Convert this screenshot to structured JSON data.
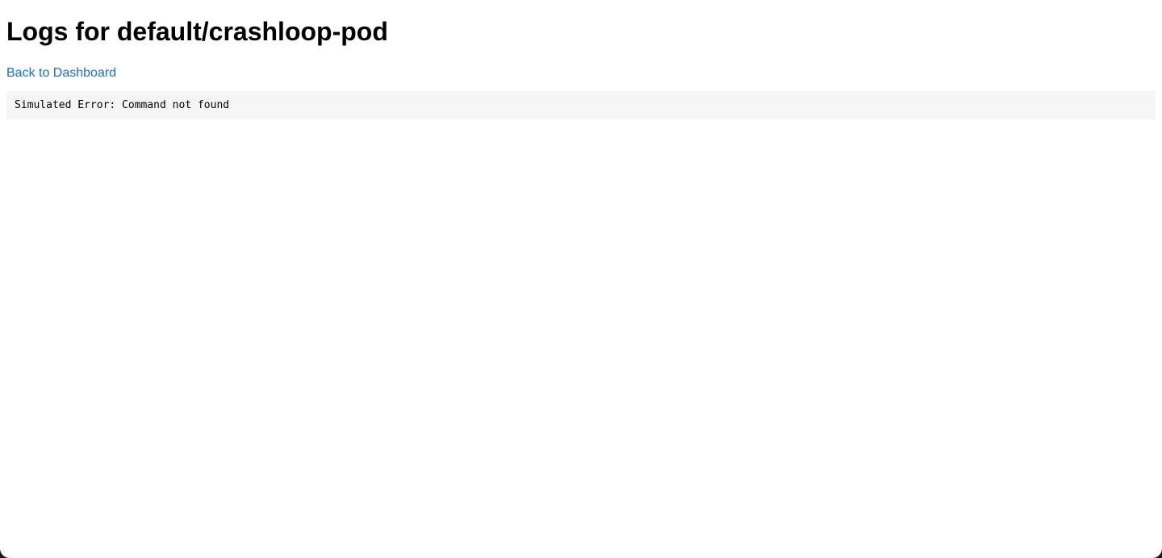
{
  "page": {
    "title": "Logs for default/crashloop-pod",
    "back_link_label": "Back to Dashboard",
    "log_output": "Simulated Error: Command not found"
  },
  "colors": {
    "link": "#1a6fe0",
    "log_background": "#f5f5f5",
    "page_background": "#ffffff"
  }
}
